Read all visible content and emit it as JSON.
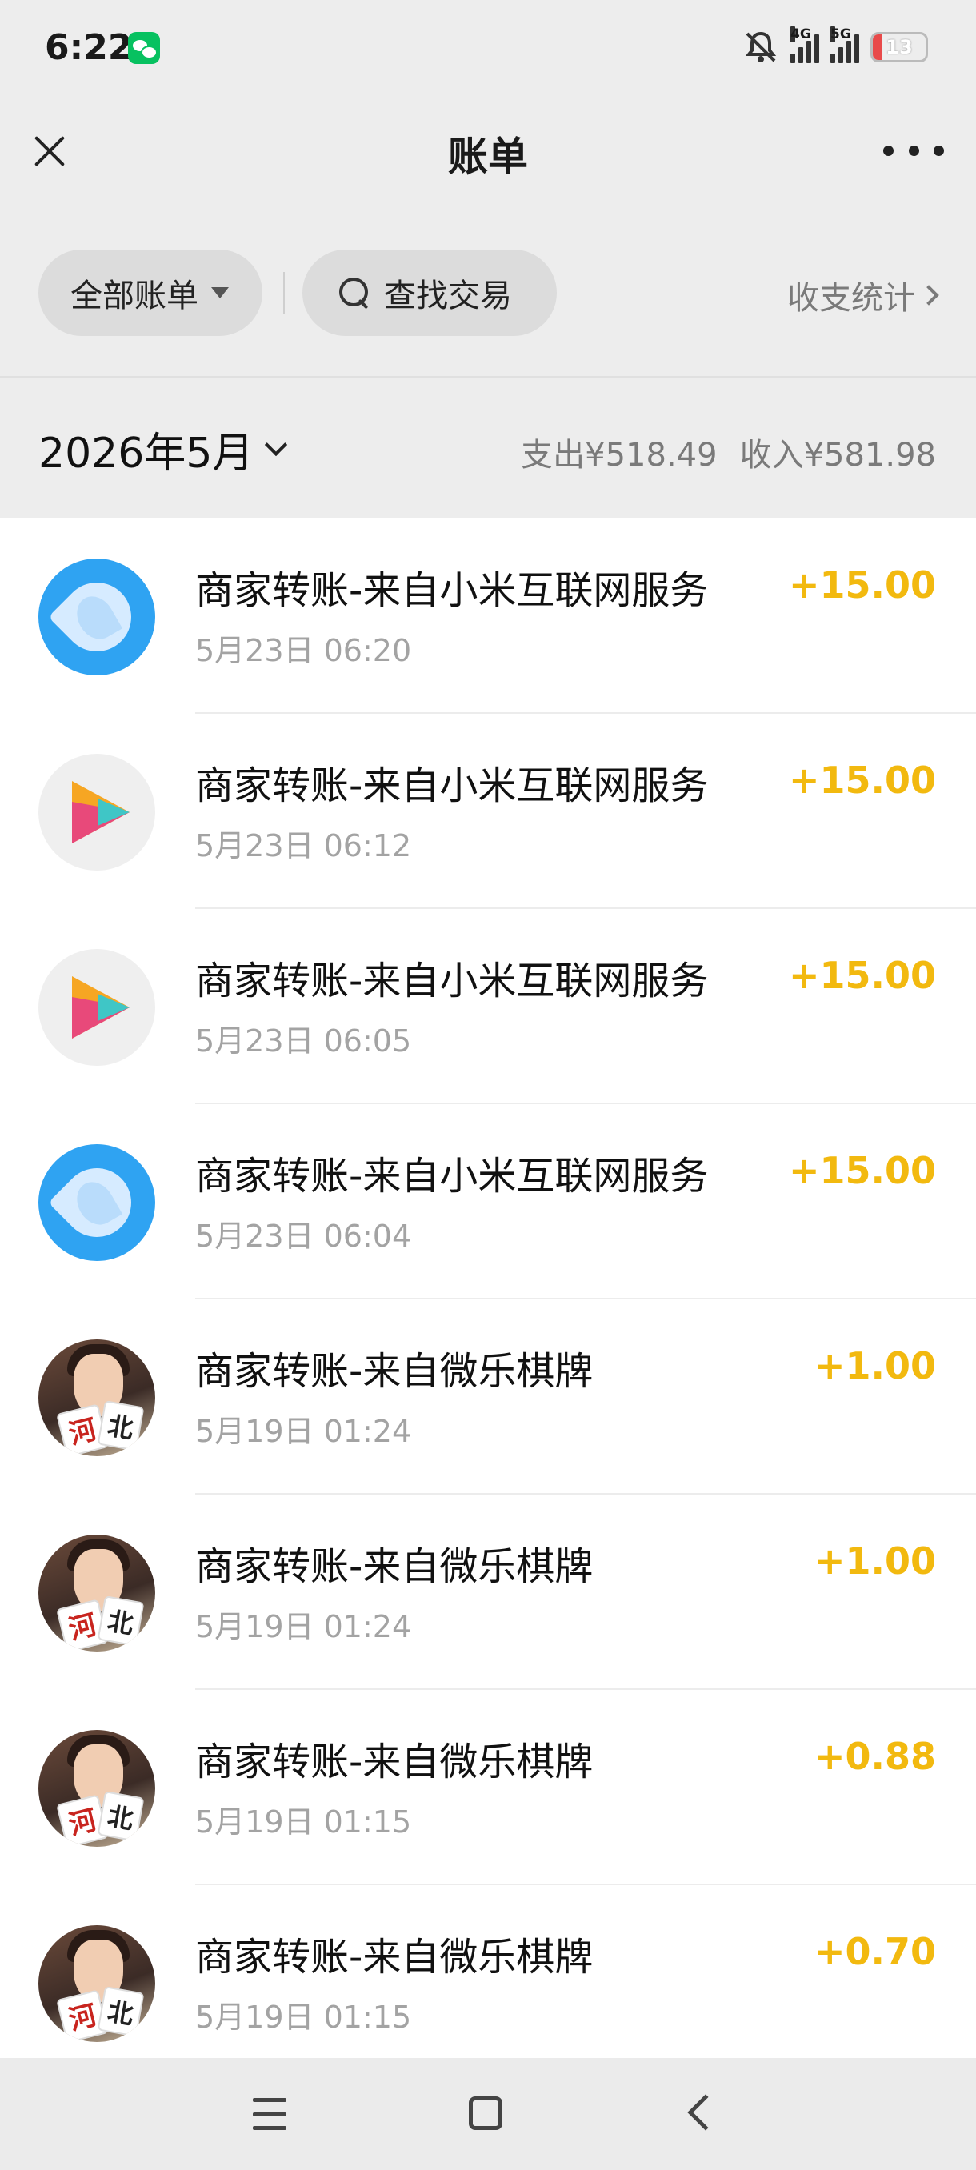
{
  "statusbar": {
    "time": "6:22",
    "network_1": "4G",
    "network_2": "5G",
    "battery": "13"
  },
  "navbar": {
    "title": "账单"
  },
  "filters": {
    "all_bills": "全部账单",
    "search": "查找交易",
    "stats": "收支统计"
  },
  "month": {
    "label": "2026年5月",
    "expense": "支出¥518.49",
    "income": "收入¥581.98"
  },
  "transactions": [
    {
      "title": "商家转账-来自小米互联网服务",
      "time": "5月23日 06:20",
      "amount": "+15.00",
      "icon": "browser-app-icon"
    },
    {
      "title": "商家转账-来自小米互联网服务",
      "time": "5月23日 06:12",
      "amount": "+15.00",
      "icon": "video-app-icon"
    },
    {
      "title": "商家转账-来自小米互联网服务",
      "time": "5月23日 06:05",
      "amount": "+15.00",
      "icon": "video-app-icon"
    },
    {
      "title": "商家转账-来自小米互联网服务",
      "time": "5月23日 06:04",
      "amount": "+15.00",
      "icon": "browser-app-icon"
    },
    {
      "title": "商家转账-来自微乐棋牌",
      "time": "5月19日 01:24",
      "amount": "+1.00",
      "icon": "game-avatar-icon"
    },
    {
      "title": "商家转账-来自微乐棋牌",
      "time": "5月19日 01:24",
      "amount": "+1.00",
      "icon": "game-avatar-icon"
    },
    {
      "title": "商家转账-来自微乐棋牌",
      "time": "5月19日 01:15",
      "amount": "+0.88",
      "icon": "game-avatar-icon"
    },
    {
      "title": "商家转账-来自微乐棋牌",
      "time": "5月19日 01:15",
      "amount": "+0.70",
      "icon": "game-avatar-icon"
    }
  ],
  "game_avatar_text": {
    "card1": "河",
    "card2": "北"
  },
  "colors": {
    "amount": "#f2b90f",
    "background": "#ededed",
    "browser_icon": "#2fa3f2",
    "wechat_green": "#07c160"
  }
}
